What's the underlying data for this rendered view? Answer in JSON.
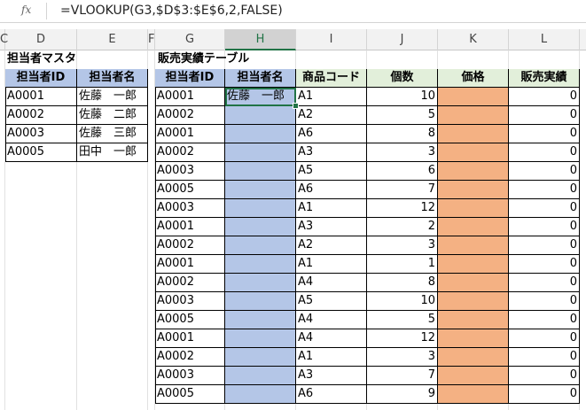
{
  "formula_bar": {
    "fx_label": "fx",
    "formula": "=VLOOKUP(G3,$D$3:$E$6,2,FALSE)"
  },
  "columns": [
    {
      "id": "C",
      "label": "C"
    },
    {
      "id": "D",
      "label": "D"
    },
    {
      "id": "E",
      "label": "E"
    },
    {
      "id": "F",
      "label": "F"
    },
    {
      "id": "G",
      "label": "G"
    },
    {
      "id": "H",
      "label": "H"
    },
    {
      "id": "I",
      "label": "I"
    },
    {
      "id": "J",
      "label": "J"
    },
    {
      "id": "K",
      "label": "K"
    },
    {
      "id": "L",
      "label": "L"
    }
  ],
  "selected_column": "H",
  "master_table": {
    "title": "担当者マスタ",
    "headers": [
      "担当者ID",
      "担当者名"
    ],
    "rows": [
      [
        "A0001",
        "佐藤　一郎"
      ],
      [
        "A0002",
        "佐藤　二郎"
      ],
      [
        "A0003",
        "佐藤　三郎"
      ],
      [
        "A0005",
        "田中　一郎"
      ]
    ]
  },
  "sales_table": {
    "title": "販売実績テーブル",
    "headers": [
      "担当者ID",
      "担当者名",
      "商品コード",
      "個数",
      "価格",
      "販売実績"
    ],
    "rows": [
      [
        "A0001",
        "佐藤　一郎",
        "A1",
        "10",
        "",
        "0"
      ],
      [
        "A0002",
        "",
        "A2",
        "5",
        "",
        "0"
      ],
      [
        "A0001",
        "",
        "A6",
        "8",
        "",
        "0"
      ],
      [
        "A0002",
        "",
        "A3",
        "3",
        "",
        "0"
      ],
      [
        "A0003",
        "",
        "A5",
        "6",
        "",
        "0"
      ],
      [
        "A0005",
        "",
        "A6",
        "7",
        "",
        "0"
      ],
      [
        "A0003",
        "",
        "A1",
        "12",
        "",
        "0"
      ],
      [
        "A0001",
        "",
        "A3",
        "2",
        "",
        "0"
      ],
      [
        "A0002",
        "",
        "A2",
        "3",
        "",
        "0"
      ],
      [
        "A0001",
        "",
        "A1",
        "1",
        "",
        "0"
      ],
      [
        "A0002",
        "",
        "A4",
        "8",
        "",
        "0"
      ],
      [
        "A0003",
        "",
        "A5",
        "10",
        "",
        "0"
      ],
      [
        "A0005",
        "",
        "A4",
        "5",
        "",
        "0"
      ],
      [
        "A0001",
        "",
        "A4",
        "12",
        "",
        "0"
      ],
      [
        "A0002",
        "",
        "A1",
        "3",
        "",
        "0"
      ],
      [
        "A0003",
        "",
        "A3",
        "7",
        "",
        "0"
      ],
      [
        "A0005",
        "",
        "A6",
        "9",
        "",
        "0"
      ]
    ]
  },
  "colors": {
    "header_blue": "#b4c6e7",
    "header_green": "#e2efda",
    "fill_orange": "#f4b183",
    "selection_green": "#217346"
  }
}
